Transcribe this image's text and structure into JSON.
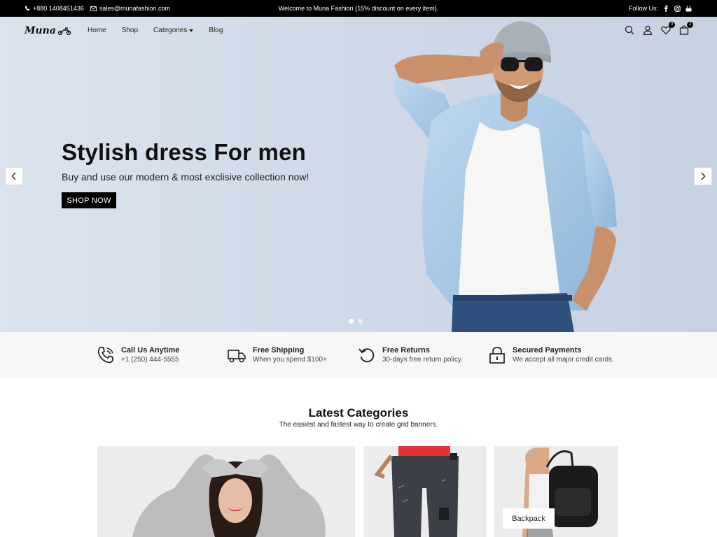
{
  "topbar": {
    "phone": "+880 1408451436",
    "email": "sales@munafashion.com",
    "welcome": "Welcome to Muna Fashion (15% discount on every item).",
    "follow_label": "Follow Us:",
    "social_icons": [
      "facebook-icon",
      "instagram-icon",
      "youtube-icon"
    ]
  },
  "header": {
    "logo": "Muna",
    "nav": [
      "Home",
      "Shop",
      "Categories",
      "Blog"
    ],
    "wishlist_count": "0",
    "cart_count": "2"
  },
  "hero": {
    "title": "Stylish dress For men",
    "subtitle": "Buy and use our modern & most exclisive collection now!",
    "button": "SHOP NOW",
    "slides": 2,
    "active_slide": 1
  },
  "features": [
    {
      "title": "Call Us Anytime",
      "desc": "+1 (250) 444-5555",
      "icon": "phone-icon"
    },
    {
      "title": "Free Shipping",
      "desc": "When you spend $100+",
      "icon": "truck-icon"
    },
    {
      "title": "Free Returns",
      "desc": "30-days free return policy.",
      "icon": "return-icon"
    },
    {
      "title": "Secured Payments",
      "desc": "We accept all major credit cards.",
      "icon": "lock-icon"
    }
  ],
  "categories": {
    "title": "Latest Categories",
    "subtitle": "The easiest and fastest way to create grid banners.",
    "items": [
      {
        "label": ""
      },
      {
        "label": ""
      },
      {
        "label": "Backpack"
      }
    ]
  },
  "colors": {
    "topbar_bg": "#000000",
    "hero_bg": "#d3dcea",
    "button_bg": "#000000"
  }
}
